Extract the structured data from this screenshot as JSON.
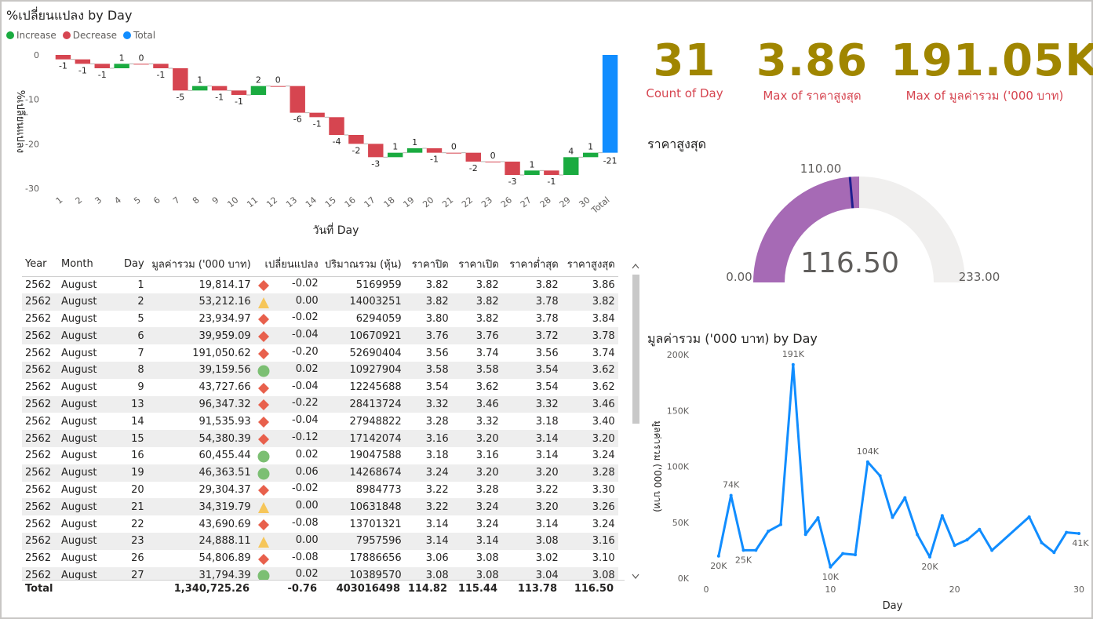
{
  "waterfall": {
    "title": "%เปลี่ยนแปลง by Day",
    "legend": [
      {
        "label": "Increase",
        "color": "#1aab40"
      },
      {
        "label": "Decrease",
        "color": "#d64550"
      },
      {
        "label": "Total",
        "color": "#118dff"
      }
    ],
    "xlabel": "วันที่ Day",
    "ylabel": "%เปลี่ยนแปลง",
    "yticks": [
      "0",
      "-10",
      "-20",
      "-30"
    ]
  },
  "kpis": [
    {
      "value": "31",
      "label": "Count of Day"
    },
    {
      "value": "3.86",
      "label": "Max of ราคาสูงสุด"
    },
    {
      "value": "191.05K",
      "label": "Max of มูลค่ารวม ('000 บาท)"
    }
  ],
  "gauge": {
    "title": "ราคาสูงสุด",
    "min_label": "0.00",
    "max_label": "233.00",
    "target_label": "110.00",
    "value_label": "116.50",
    "min": 0,
    "max": 233,
    "value": 116.5,
    "target": 110,
    "fill_color": "#a66ab5",
    "track_color": "#f0efee",
    "target_color": "#1f1f8f"
  },
  "table": {
    "headers": [
      "Year",
      "Month",
      "Day",
      "มูลค่ารวม ('000 บาท)",
      "เปลี่ยนแปลง",
      "ปริมาณรวม (หุ้น)",
      "ราคาปิด",
      "ราคาเปิด",
      "ราคาต่ำสุด",
      "ราคาสูงสุด"
    ],
    "rows": [
      [
        "2562",
        "August",
        "1",
        "19,814.17",
        "-0.02",
        "5169959",
        "3.82",
        "3.82",
        "3.82",
        "3.86"
      ],
      [
        "2562",
        "August",
        "2",
        "53,212.16",
        "0.00",
        "14003251",
        "3.82",
        "3.82",
        "3.78",
        "3.82"
      ],
      [
        "2562",
        "August",
        "5",
        "23,934.97",
        "-0.02",
        "6294059",
        "3.80",
        "3.82",
        "3.78",
        "3.84"
      ],
      [
        "2562",
        "August",
        "6",
        "39,959.09",
        "-0.04",
        "10670921",
        "3.76",
        "3.76",
        "3.72",
        "3.78"
      ],
      [
        "2562",
        "August",
        "7",
        "191,050.62",
        "-0.20",
        "52690404",
        "3.56",
        "3.74",
        "3.56",
        "3.74"
      ],
      [
        "2562",
        "August",
        "8",
        "39,159.56",
        "0.02",
        "10927904",
        "3.58",
        "3.58",
        "3.54",
        "3.62"
      ],
      [
        "2562",
        "August",
        "9",
        "43,727.66",
        "-0.04",
        "12245688",
        "3.54",
        "3.62",
        "3.54",
        "3.62"
      ],
      [
        "2562",
        "August",
        "13",
        "96,347.32",
        "-0.22",
        "28413724",
        "3.32",
        "3.46",
        "3.32",
        "3.46"
      ],
      [
        "2562",
        "August",
        "14",
        "91,535.93",
        "-0.04",
        "27948822",
        "3.28",
        "3.32",
        "3.18",
        "3.40"
      ],
      [
        "2562",
        "August",
        "15",
        "54,380.39",
        "-0.12",
        "17142074",
        "3.16",
        "3.20",
        "3.14",
        "3.20"
      ],
      [
        "2562",
        "August",
        "16",
        "60,455.44",
        "0.02",
        "19047588",
        "3.18",
        "3.16",
        "3.14",
        "3.24"
      ],
      [
        "2562",
        "August",
        "19",
        "46,363.51",
        "0.06",
        "14268674",
        "3.24",
        "3.20",
        "3.20",
        "3.28"
      ],
      [
        "2562",
        "August",
        "20",
        "29,304.37",
        "-0.02",
        "8984773",
        "3.22",
        "3.28",
        "3.22",
        "3.30"
      ],
      [
        "2562",
        "August",
        "21",
        "34,319.79",
        "0.00",
        "10631848",
        "3.22",
        "3.24",
        "3.20",
        "3.26"
      ],
      [
        "2562",
        "August",
        "22",
        "43,690.69",
        "-0.08",
        "13701321",
        "3.14",
        "3.24",
        "3.14",
        "3.24"
      ],
      [
        "2562",
        "August",
        "23",
        "24,888.11",
        "0.00",
        "7957596",
        "3.14",
        "3.14",
        "3.08",
        "3.16"
      ],
      [
        "2562",
        "August",
        "26",
        "54,806.89",
        "-0.08",
        "17886656",
        "3.06",
        "3.08",
        "3.02",
        "3.10"
      ],
      [
        "2562",
        "August",
        "27",
        "31,794.39",
        "0.02",
        "10389570",
        "3.08",
        "3.08",
        "3.04",
        "3.08"
      ]
    ],
    "row_icons": [
      "diamond",
      "triangle",
      "diamond",
      "diamond",
      "diamond",
      "circle",
      "diamond",
      "diamond",
      "diamond",
      "diamond",
      "circle",
      "circle",
      "diamond",
      "triangle",
      "diamond",
      "triangle",
      "diamond",
      "circle"
    ],
    "icon_colors": {
      "diamond": "#e8604c",
      "triangle": "#f6c65a",
      "circle": "#7cbf73"
    },
    "total": [
      "Total",
      "",
      "",
      "1,340,725.26",
      "-0.76",
      "403016498",
      "114.82",
      "115.44",
      "113.78",
      "116.50"
    ]
  },
  "line": {
    "title": "มูลค่ารวม ('000 บาท) by Day",
    "xlabel": "Day",
    "ylabel": "มูลค่ารวม ('000 บาท)",
    "color": "#118dff"
  },
  "chart_data": [
    {
      "type": "bar",
      "subtype": "waterfall",
      "title": "%เปลี่ยนแปลง by Day",
      "xlabel": "วันที่ Day",
      "ylabel": "%เปลี่ยนแปลง",
      "ylim": [
        -30,
        0
      ],
      "categories": [
        "1",
        "2",
        "3",
        "4",
        "5",
        "6",
        "7",
        "8",
        "9",
        "10",
        "11",
        "12",
        "13",
        "14",
        "15",
        "16",
        "17",
        "18",
        "19",
        "20",
        "21",
        "22",
        "23",
        "26",
        "27",
        "28",
        "29",
        "30",
        "Total"
      ],
      "values": [
        -1,
        -1,
        -1,
        1,
        0,
        -1,
        -5,
        1,
        -1,
        -1,
        2,
        0,
        -6,
        -1,
        -4,
        -2,
        -3,
        1,
        1,
        -1,
        0,
        -2,
        0,
        -3,
        1,
        -1,
        4,
        1,
        -21
      ],
      "labels": [
        "-1",
        "-1",
        "-1",
        "1",
        "0",
        "-1",
        "-5",
        "1",
        "-1",
        "-1",
        "2",
        "0",
        "-6",
        "-1",
        "-4",
        "-2",
        "-3",
        "1",
        "1",
        "-1",
        "0",
        "-2",
        "0",
        "-3",
        "1",
        "-1",
        "4",
        "1",
        "-21"
      ]
    },
    {
      "type": "line",
      "title": "มูลค่ารวม ('000 บาท) by Day",
      "xlabel": "Day",
      "ylabel": "มูลค่ารวม ('000 บาท)",
      "xlim": [
        0,
        30
      ],
      "ylim": [
        0,
        200000
      ],
      "xticks": [
        "0",
        "10",
        "20",
        "30"
      ],
      "yticks": [
        "0K",
        "50K",
        "100K",
        "150K",
        "200K"
      ],
      "x": [
        1,
        2,
        3,
        4,
        5,
        6,
        7,
        8,
        9,
        10,
        11,
        12,
        13,
        14,
        15,
        16,
        17,
        18,
        19,
        20,
        21,
        22,
        23,
        26,
        27,
        28,
        29,
        30
      ],
      "y": [
        19814,
        74000,
        25000,
        25000,
        42000,
        48000,
        191051,
        39160,
        54000,
        10000,
        22000,
        21000,
        104000,
        91536,
        54380,
        72000,
        39000,
        19000,
        56000,
        29304,
        34320,
        43691,
        24888,
        54807,
        31794,
        23000,
        41000,
        40000
      ],
      "data_labels": [
        {
          "x": 1,
          "text": "20K"
        },
        {
          "x": 2,
          "text": "74K"
        },
        {
          "x": 3,
          "text": "25K"
        },
        {
          "x": 7,
          "text": "191K"
        },
        {
          "x": 10,
          "text": "10K"
        },
        {
          "x": 13,
          "text": "104K"
        },
        {
          "x": 18,
          "text": "20K"
        },
        {
          "x": 30,
          "text": "41K"
        }
      ]
    }
  ]
}
